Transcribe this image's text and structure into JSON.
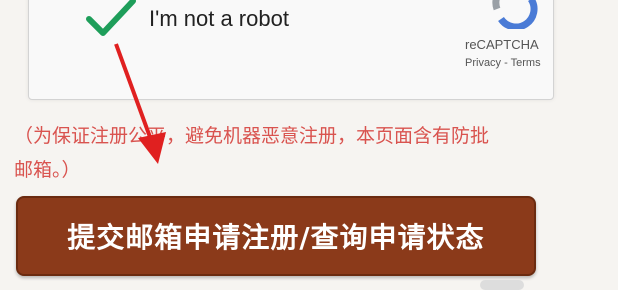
{
  "captcha": {
    "label": "I'm not a robot",
    "brand": "reCAPTCHA",
    "privacy": "Privacy",
    "separator": " - ",
    "terms": "Terms"
  },
  "notice": {
    "line1": "（为保证注册公平，避免机器恶意注册，本页面含有防批",
    "line2": "邮箱。）"
  },
  "submit": {
    "label": "提交邮箱申请注册/查询申请状态"
  },
  "colors": {
    "accent": "#8b3a1a",
    "notice": "#d9534f",
    "check": "#1e9e5a",
    "arrow": "#e02020"
  }
}
